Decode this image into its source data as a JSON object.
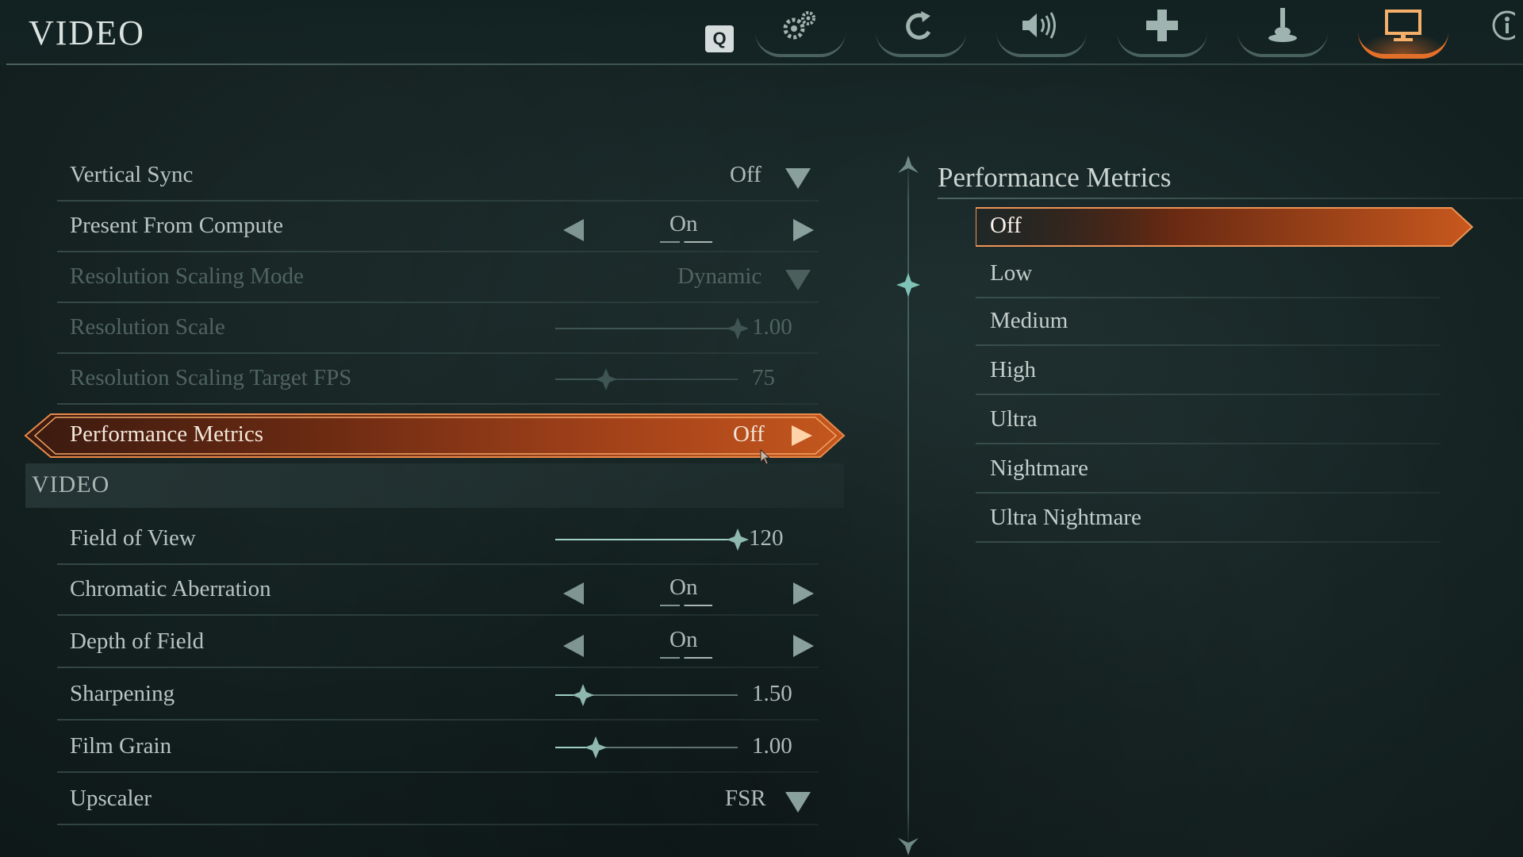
{
  "header": {
    "title": "VIDEO",
    "q_key": "Q",
    "tabs": [
      {
        "icon": "gears-icon",
        "active": false
      },
      {
        "icon": "reset-arrow-icon",
        "active": false
      },
      {
        "icon": "speaker-icon",
        "active": false
      },
      {
        "icon": "dpad-icon",
        "active": false
      },
      {
        "icon": "joystick-icon",
        "active": false
      },
      {
        "icon": "monitor-icon",
        "active": true
      },
      {
        "icon": "accessibility-icon",
        "active": false
      }
    ]
  },
  "settings": {
    "vertical_sync": {
      "label": "Vertical Sync",
      "value": "Off"
    },
    "present_from_compute": {
      "label": "Present From Compute",
      "value": "On"
    },
    "resolution_scaling_mode": {
      "label": "Resolution Scaling Mode",
      "value": "Dynamic"
    },
    "resolution_scale": {
      "label": "Resolution Scale",
      "value": "1.00",
      "level": 1.0
    },
    "resolution_scaling_target_fps": {
      "label": "Resolution Scaling Target FPS",
      "value": "75",
      "level": 0.28
    },
    "performance_metrics": {
      "label": "Performance Metrics",
      "value": "Off"
    }
  },
  "video_section": {
    "title": "VIDEO",
    "field_of_view": {
      "label": "Field of View",
      "value": "120",
      "level": 1.0
    },
    "chromatic_aberration": {
      "label": "Chromatic Aberration",
      "value": "On"
    },
    "depth_of_field": {
      "label": "Depth of Field",
      "value": "On"
    },
    "sharpening": {
      "label": "Sharpening",
      "value": "1.50",
      "level": 0.15
    },
    "film_grain": {
      "label": "Film Grain",
      "value": "1.00",
      "level": 0.22
    },
    "upscaler": {
      "label": "Upscaler",
      "value": "FSR"
    }
  },
  "options_panel": {
    "title": "Performance Metrics",
    "options": [
      "Off",
      "Low",
      "Medium",
      "High",
      "Ultra",
      "Nightmare",
      "Ultra Nightmare"
    ],
    "selected": "Off"
  },
  "colors": {
    "accent": "#e2702a",
    "highlight_text": "#f3e6d9"
  }
}
